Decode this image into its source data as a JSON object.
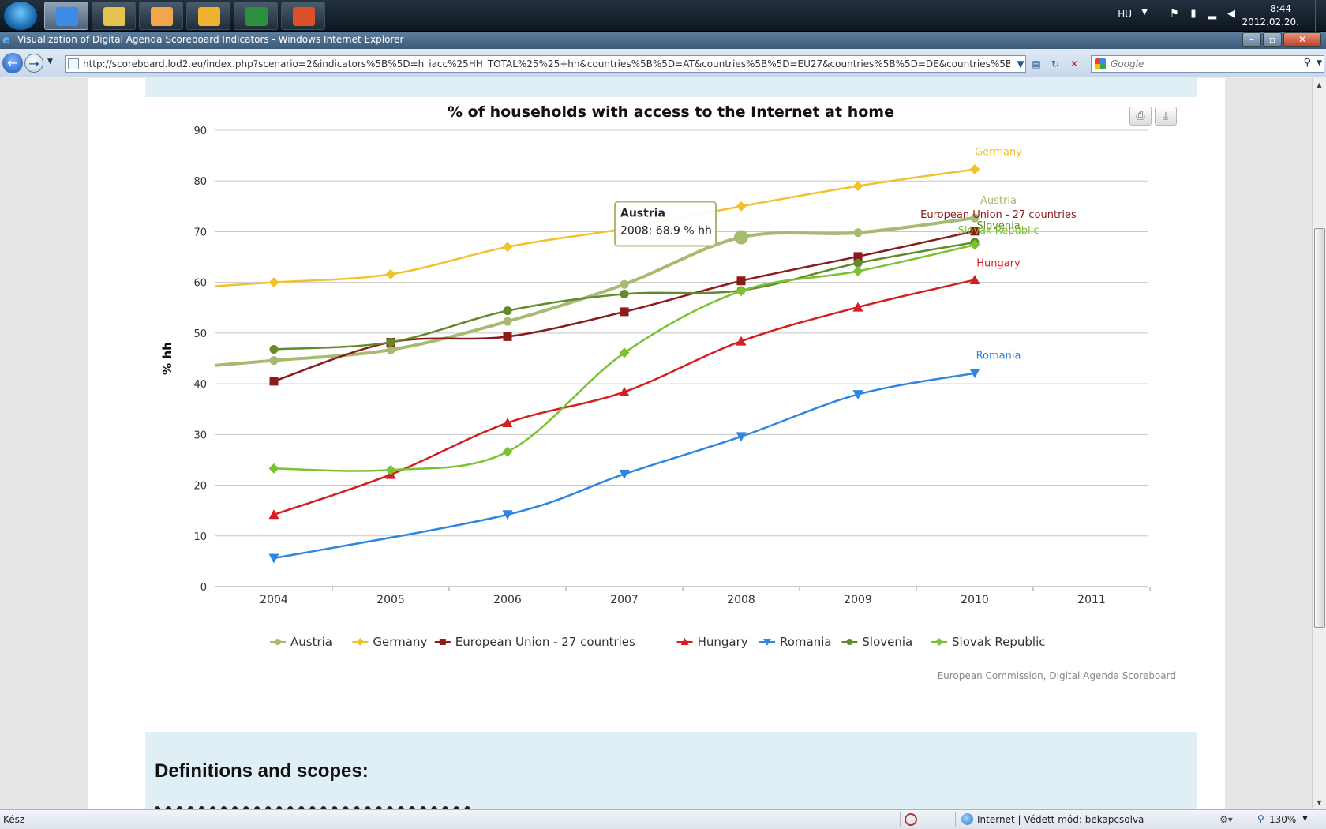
{
  "taskbar": {
    "language": "HU",
    "time": "8:44",
    "date": "2012.02.20.",
    "apps": [
      {
        "name": "internet-explorer",
        "color": "#3d8be6"
      },
      {
        "name": "file-explorer",
        "color": "#e6c250"
      },
      {
        "name": "media-player",
        "color": "#f2a54a"
      },
      {
        "name": "outlook",
        "color": "#f0b030"
      },
      {
        "name": "excel",
        "color": "#2e8f3e"
      },
      {
        "name": "powerpoint",
        "color": "#d9502a"
      }
    ]
  },
  "window": {
    "title": "Visualization of Digital Agenda Scoreboard Indicators - Windows Internet Explorer"
  },
  "address_bar": {
    "url": "http://scoreboard.lod2.eu/index.php?scenario=2&indicators%5B%5D=h_iacc%25HH_TOTAL%25%25+hh&countries%5B%5D=AT&countries%5B%5D=EU27&countries%5B%5D=DE&countries%5B%5D=HU&countries%5B%",
    "search_placeholder": "Google"
  },
  "chart_data": {
    "type": "line",
    "title": "% of households with access to the Internet at home",
    "ylabel": "% hh",
    "xlabel": "",
    "x": [
      2004,
      2005,
      2006,
      2007,
      2008,
      2009,
      2010,
      2011
    ],
    "ylim": [
      0,
      90
    ],
    "yticks": [
      0,
      10,
      20,
      30,
      40,
      50,
      60,
      70,
      80,
      90
    ],
    "grid": true,
    "legend_position": "bottom",
    "credits": "European Commission, Digital Agenda Scoreboard",
    "tooltip": {
      "series": "Austria",
      "text": "2008: 68.9 % hh"
    },
    "series": [
      {
        "name": "Austria",
        "color": "#a6ba72",
        "marker": "circle",
        "values": [
          44.6,
          46.7,
          52.3,
          59.6,
          68.9,
          69.8,
          72.7,
          null
        ]
      },
      {
        "name": "Germany",
        "color": "#f2c12e",
        "marker": "diamond",
        "values": [
          60.0,
          61.6,
          67.0,
          70.6,
          75.0,
          79.0,
          82.3,
          null
        ]
      },
      {
        "name": "European Union - 27 countries",
        "color": "#8b1a1a",
        "marker": "square",
        "values": [
          40.5,
          48.2,
          49.3,
          54.2,
          60.3,
          65.1,
          70.1,
          null
        ]
      },
      {
        "name": "Hungary",
        "color": "#d41f22",
        "marker": "triangle",
        "values": [
          14.2,
          22.1,
          32.3,
          38.4,
          48.4,
          55.1,
          60.5,
          null
        ]
      },
      {
        "name": "Romania",
        "color": "#2e86de",
        "marker": "triangle-down",
        "values": [
          5.6,
          null,
          14.2,
          22.2,
          29.6,
          37.9,
          42.1,
          null
        ]
      },
      {
        "name": "Slovenia",
        "color": "#628a2a",
        "marker": "circle",
        "values": [
          46.8,
          48.2,
          54.4,
          57.7,
          58.4,
          63.8,
          67.9,
          null
        ]
      },
      {
        "name": "Slovak Republic",
        "color": "#7bc232",
        "marker": "diamond",
        "values": [
          23.3,
          23.0,
          26.6,
          46.1,
          58.3,
          62.2,
          67.4,
          null
        ]
      }
    ]
  },
  "export": {
    "print_icon": "printer-icon",
    "download_icon": "download-icon"
  },
  "section": {
    "heading": "Definitions and scopes:"
  },
  "statusbar": {
    "status": "Kész",
    "zone": "Internet | Védett mód: bekapcsolva",
    "zoom": "130%"
  }
}
